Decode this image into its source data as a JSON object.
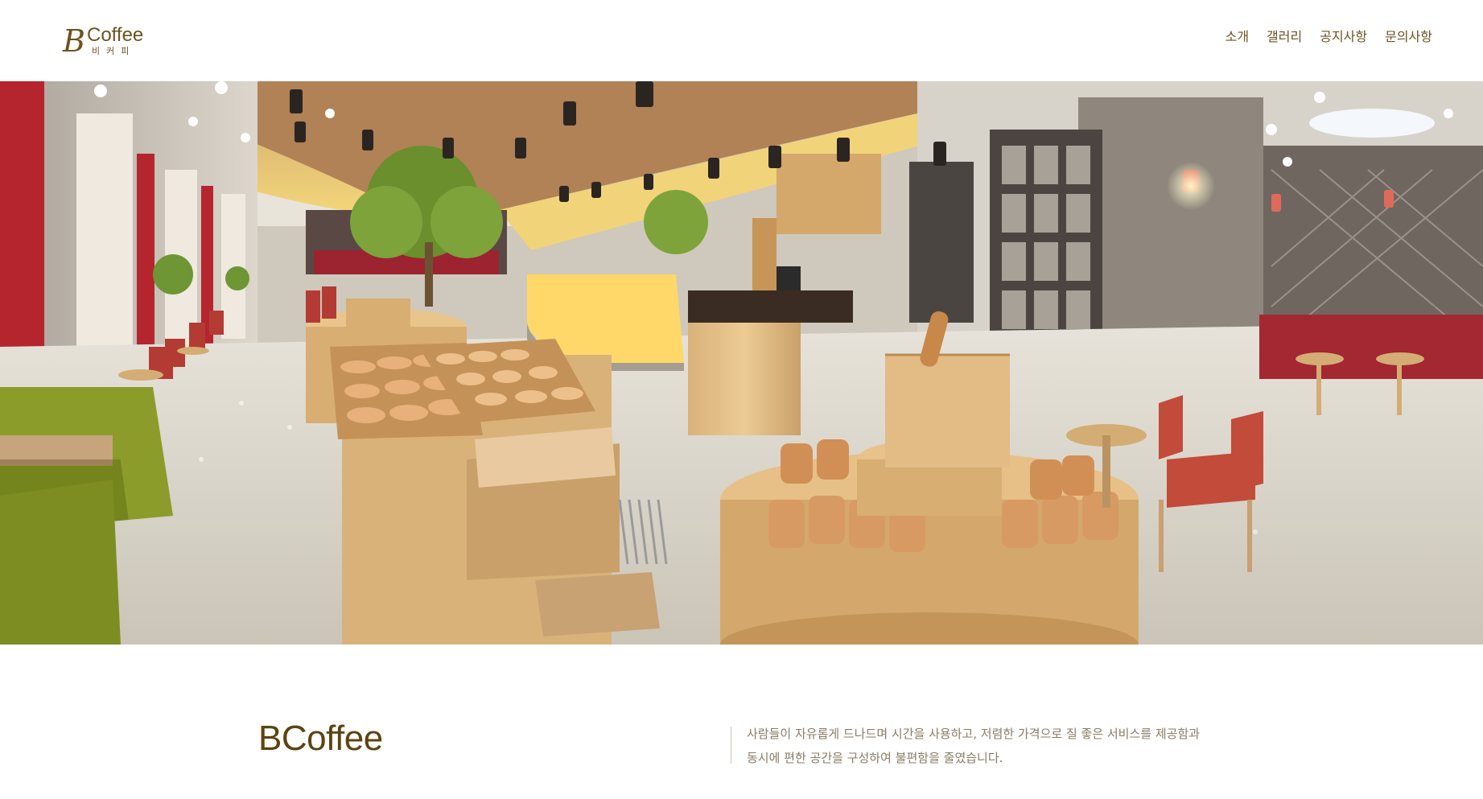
{
  "header": {
    "logo": {
      "letter": "B",
      "word": "Coffee",
      "sub": "비커피"
    },
    "nav": [
      {
        "label": "소개"
      },
      {
        "label": "갤러리"
      },
      {
        "label": "공지사항"
      },
      {
        "label": "문의사항"
      }
    ]
  },
  "hero": {
    "icon": "cafe-interior-photo"
  },
  "intro": {
    "title": "BCoffee",
    "lines": [
      "사람들이 자유롭게 드나드며 시간을 사용하고, 저렴한 가격으로 질 좋은 서비스를 제공함과",
      "동시에 편한 공간을 구성하여 불편함을 줄였습니다."
    ]
  },
  "colors": {
    "brand": "#6b5320",
    "title": "#5c4412",
    "body_text": "#8a7c66"
  }
}
